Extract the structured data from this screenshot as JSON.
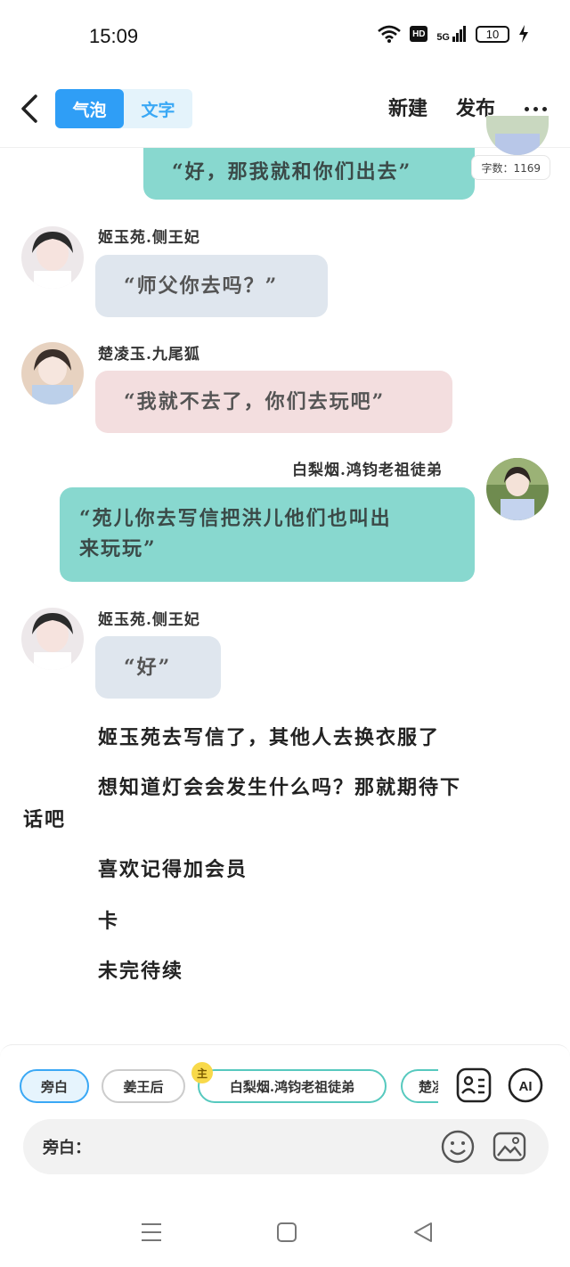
{
  "status_bar": {
    "time": "15:09",
    "network": "5G",
    "hd": "HD",
    "battery": "10"
  },
  "nav": {
    "tabs": [
      {
        "label": "气泡",
        "active": true
      },
      {
        "label": "文字",
        "active": false
      }
    ],
    "new_label": "新建",
    "publish_label": "发布"
  },
  "word_count": "字数：1169",
  "messages": [
    {
      "speaker": "",
      "side": "right",
      "text": "“好，那我就和你们出去”",
      "color": "#88d8cf"
    },
    {
      "speaker": "姬玉苑.侧王妃",
      "side": "left",
      "text": "“师父你去吗？”",
      "color": "#dfe6ee"
    },
    {
      "speaker": "楚凌玉.九尾狐",
      "side": "left",
      "text": "“我就不去了，你们去玩吧”",
      "color": "#f3dedf"
    },
    {
      "speaker": "白梨烟.鸿钧老祖徒弟",
      "side": "right",
      "text": "“苑儿你去写信把洪儿他们也叫出来玩玩”",
      "line1": "“苑儿你去写信把洪儿他们也叫出",
      "line2": "来玩玩”",
      "color": "#88d8cf"
    },
    {
      "speaker": "姬玉苑.侧王妃",
      "side": "left",
      "text": "“好”",
      "color": "#dfe6ee"
    }
  ],
  "narration": [
    "姬玉苑去写信了，其他人去换衣服了",
    "想知道灯会会发生什么吗？那就期待下",
    "话吧",
    "喜欢记得加会员",
    "卡",
    "未完待续"
  ],
  "characters": [
    {
      "label": "旁白",
      "selected": true
    },
    {
      "label": "姜王后",
      "selected": false
    },
    {
      "label": "白梨烟.鸿钧老祖徒弟",
      "badge": "主",
      "selected": false
    },
    {
      "label": "楚凌",
      "selected": false
    }
  ],
  "input": {
    "label": "旁白："
  },
  "icons": {
    "back": "chevron-left-icon",
    "more": "more-horizontal-icon",
    "character_list": "contact-card-icon",
    "ai": "ai-icon",
    "emoji": "emoji-icon",
    "image": "image-icon"
  },
  "colors": {
    "accent": "#2f9ef6",
    "teal": "#88d8cf",
    "gray_bubble": "#dfe6ee",
    "pink_bubble": "#f3dedf"
  }
}
